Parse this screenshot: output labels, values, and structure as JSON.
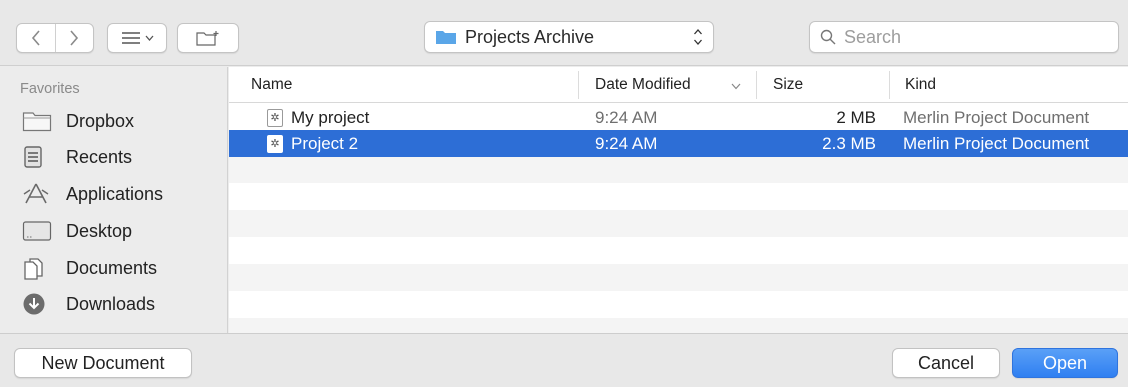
{
  "toolbar": {
    "location": "Projects Archive",
    "search_placeholder": "Search"
  },
  "sidebar": {
    "heading": "Favorites",
    "items": [
      {
        "label": "Dropbox",
        "icon": "folder-icon"
      },
      {
        "label": "Recents",
        "icon": "recents-icon"
      },
      {
        "label": "Applications",
        "icon": "applications-icon"
      },
      {
        "label": "Desktop",
        "icon": "desktop-icon"
      },
      {
        "label": "Documents",
        "icon": "documents-icon"
      },
      {
        "label": "Downloads",
        "icon": "downloads-icon"
      }
    ]
  },
  "list": {
    "columns": [
      "Name",
      "Date Modified",
      "Size",
      "Kind"
    ],
    "rows": [
      {
        "name": "My project",
        "date": "9:24 AM",
        "size": "2 MB",
        "kind": "Merlin Project Document",
        "selected": false
      },
      {
        "name": "Project 2",
        "date": "9:24 AM",
        "size": "2.3 MB",
        "kind": "Merlin Project Document",
        "selected": true
      }
    ]
  },
  "footer": {
    "new_document": "New Document",
    "cancel": "Cancel",
    "open": "Open"
  },
  "colors": {
    "selection": "#2d6ed6",
    "primary_button": "#2f7ff1",
    "folder_blue": "#5aa6e8"
  }
}
